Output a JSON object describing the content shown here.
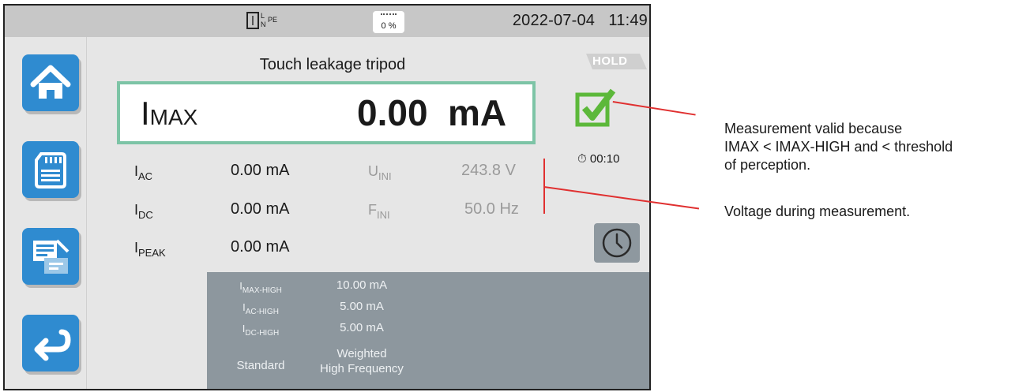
{
  "status_bar": {
    "connection": {
      "L": "L",
      "N": "N",
      "PE": "PE"
    },
    "memory": "0 %",
    "date": "2022-07-04",
    "time": "11:49"
  },
  "sidebar": [
    {
      "icon": "home-icon"
    },
    {
      "icon": "sd-card-icon"
    },
    {
      "icon": "report-icon"
    },
    {
      "icon": "back-arrow-icon"
    }
  ],
  "title": "Touch leakage tripod",
  "hold": "HOLD",
  "main": {
    "label": "I",
    "label_sub": "MAX",
    "value": "0.00",
    "unit": "mA"
  },
  "timer": "00:10",
  "measures": {
    "iac": {
      "label": "I",
      "sub": "AC",
      "value": "0.00 mA"
    },
    "idc": {
      "label": "I",
      "sub": "DC",
      "value": "0.00 mA"
    },
    "ipeak": {
      "label": "I",
      "sub": "PEAK",
      "value": "0.00 mA"
    },
    "uini": {
      "label": "U",
      "sub": "INI",
      "value": "243.8 V"
    },
    "fini": {
      "label": "F",
      "sub": "INI",
      "value": "50.0 Hz"
    }
  },
  "limits": {
    "imax_high": {
      "label": "I",
      "sub": "MAX-HIGH",
      "value": "10.00 mA"
    },
    "iac_high": {
      "label": "I",
      "sub": "AC-HIGH",
      "value": "5.00 mA"
    },
    "idc_high": {
      "label": "I",
      "sub": "DC-HIGH",
      "value": "5.00 mA"
    },
    "standard": {
      "label": "Standard",
      "value_line1": "Weighted",
      "value_line2": "High Frequency"
    }
  },
  "annotations": {
    "valid": {
      "line1": "Measurement valid because",
      "line2": "IMAX < IMAX-HIGH and < threshold",
      "line3": "of perception."
    },
    "voltage": "Voltage during measurement."
  },
  "colors": {
    "accent": "#2f8bd0",
    "valid_green": "#5cb83a",
    "box_border": "#7dc4a6",
    "leader": "#e03030"
  }
}
